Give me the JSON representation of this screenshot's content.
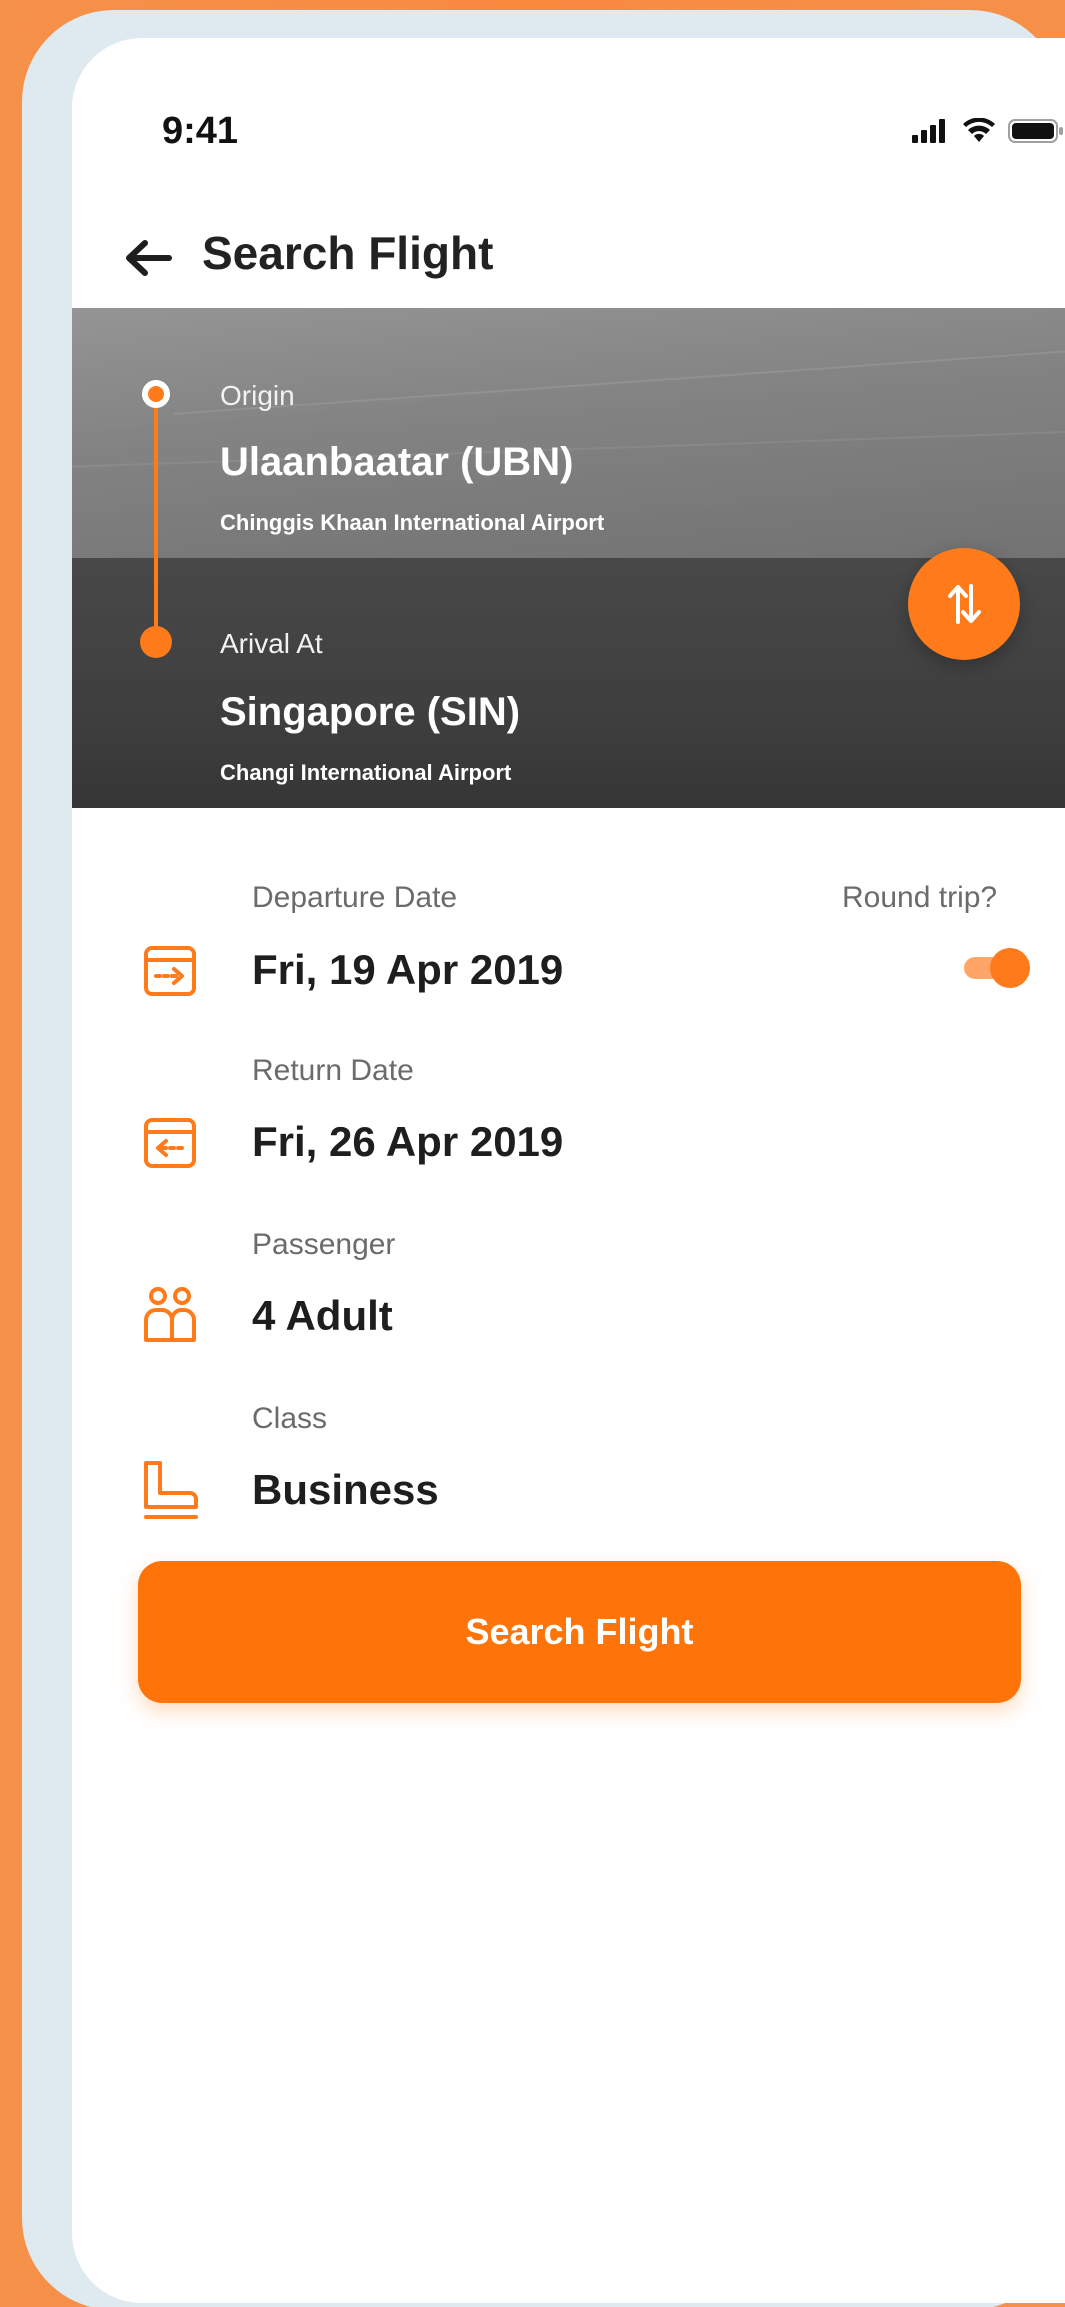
{
  "status_bar": {
    "time": "9:41",
    "icons": [
      "signal-icon",
      "wifi-icon",
      "battery-icon"
    ]
  },
  "header": {
    "back_icon": "arrow-left-icon",
    "title": "Search Flight"
  },
  "route": {
    "origin": {
      "label": "Origin",
      "city": "Ulaanbaatar (UBN)",
      "airport": "Chinggis Khaan International Airport"
    },
    "destination": {
      "label": "Arival At",
      "city": "Singapore (SIN)",
      "airport": "Changi International Airport"
    },
    "swap_icon": "swap-vertical-icon"
  },
  "form": {
    "departure": {
      "label": "Departure Date",
      "value": "Fri, 19 Apr 2019",
      "icon": "calendar-departure-icon"
    },
    "round_trip": {
      "label": "Round trip?",
      "enabled": true
    },
    "return": {
      "label": "Return Date",
      "value": "Fri, 26 Apr 2019",
      "icon": "calendar-return-icon"
    },
    "passenger": {
      "label": "Passenger",
      "value": "4 Adult",
      "icon": "passengers-icon"
    },
    "class": {
      "label": "Class",
      "value": "Business",
      "icon": "seat-icon"
    }
  },
  "search_button": {
    "label": "Search Flight"
  },
  "colors": {
    "accent": "#ff7409",
    "background": "#f88a3e",
    "text_primary": "#1e1e1e",
    "text_secondary": "#6b6b6b"
  }
}
